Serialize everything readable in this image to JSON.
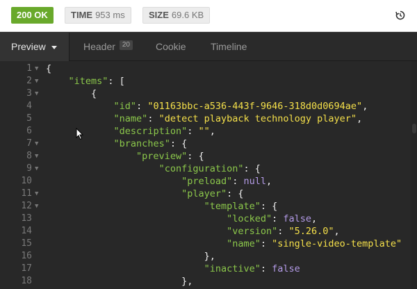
{
  "status": {
    "code_label": "200 OK",
    "time_label": "TIME",
    "time_value": "953 ms",
    "size_label": "SIZE",
    "size_value": "69.6 KB",
    "history_icon": "history-icon",
    "ok_color": "#69a92b"
  },
  "tabs": {
    "preview": "Preview",
    "header": "Header",
    "header_count": "20",
    "cookie": "Cookie",
    "timeline": "Timeline"
  },
  "code": {
    "lines": [
      {
        "n": "1",
        "fold": true
      },
      {
        "n": "2",
        "fold": true
      },
      {
        "n": "3",
        "fold": true
      },
      {
        "n": "4",
        "fold": false
      },
      {
        "n": "5",
        "fold": false
      },
      {
        "n": "6",
        "fold": false
      },
      {
        "n": "7",
        "fold": true
      },
      {
        "n": "8",
        "fold": true
      },
      {
        "n": "9",
        "fold": true
      },
      {
        "n": "10",
        "fold": false
      },
      {
        "n": "11",
        "fold": true
      },
      {
        "n": "12",
        "fold": true
      },
      {
        "n": "13",
        "fold": false
      },
      {
        "n": "14",
        "fold": false
      },
      {
        "n": "15",
        "fold": false
      },
      {
        "n": "16",
        "fold": false
      },
      {
        "n": "17",
        "fold": false
      },
      {
        "n": "18",
        "fold": false
      }
    ],
    "tokens": {
      "items_key": "\"items\"",
      "id_key": "\"id\"",
      "id_val": "\"01163bbc-a536-443f-9646-318d0d0694ae\"",
      "name_key": "\"name\"",
      "name_val": "\"detect playback technology player\"",
      "desc_key": "\"description\"",
      "desc_val": "\"\"",
      "branches_key": "\"branches\"",
      "preview_key": "\"preview\"",
      "config_key": "\"configuration\"",
      "preload_key": "\"preload\"",
      "preload_val": "null",
      "player_key": "\"player\"",
      "template_key": "\"template\"",
      "locked_key": "\"locked\"",
      "locked_val": "false",
      "version_key": "\"version\"",
      "version_val": "\"5.26.0\"",
      "tname_key": "\"name\"",
      "tname_val": "\"single-video-template\"",
      "inactive_key": "\"inactive\"",
      "inactive_val": "false"
    },
    "colors": {
      "key": "#8cc84b",
      "string": "#f5e04a",
      "constant": "#b49be8"
    }
  }
}
